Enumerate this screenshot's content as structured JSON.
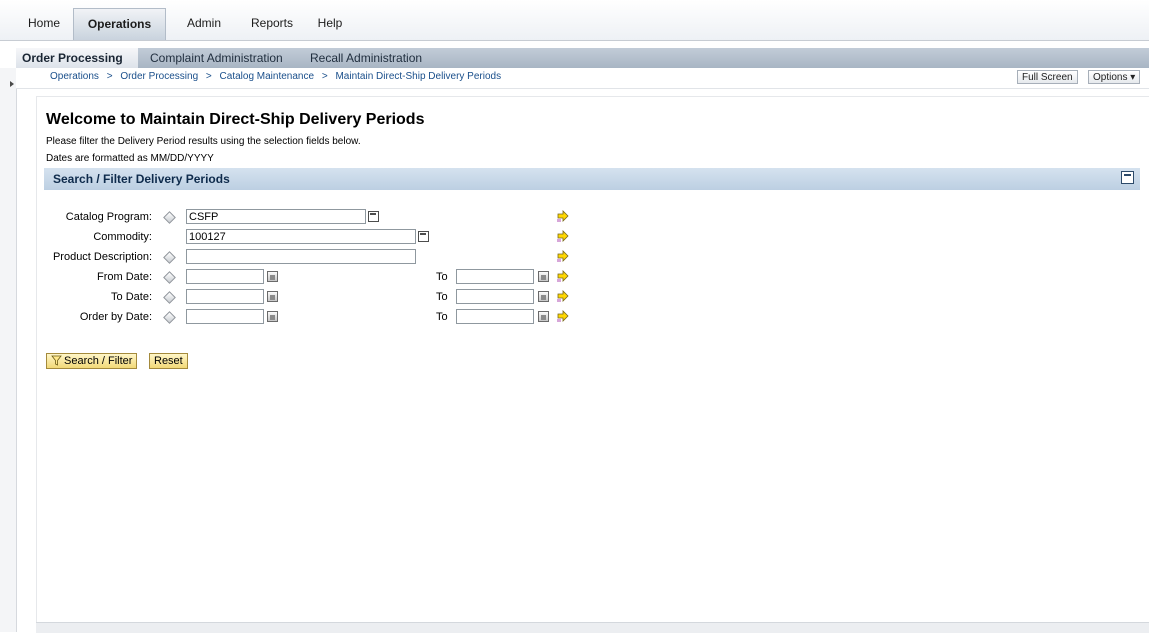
{
  "topnav": {
    "tabs": [
      {
        "label": "Home"
      },
      {
        "label": "Operations",
        "active": true
      },
      {
        "label": "Admin"
      },
      {
        "label": "Reports"
      },
      {
        "label": "Help"
      }
    ]
  },
  "subnav": {
    "tabs": [
      {
        "label": "Order Processing",
        "active": true
      },
      {
        "label": "Complaint Administration"
      },
      {
        "label": "Recall Administration"
      }
    ]
  },
  "breadcrumb": {
    "items": [
      "Operations",
      "Order Processing",
      "Catalog Maintenance",
      "Maintain Direct-Ship Delivery Periods"
    ],
    "separator": ">"
  },
  "toolbar": {
    "full_screen_label": "Full Screen",
    "options_label": "Options ▾"
  },
  "page": {
    "title": "Welcome to Maintain Direct-Ship Delivery Periods",
    "instruction": "Please filter the Delivery Period results using the selection fields below.",
    "date_format_note": "Dates are formatted as MM/DD/YYYY"
  },
  "section": {
    "title": "Search / Filter Delivery Periods"
  },
  "form": {
    "catalog_program": {
      "label": "Catalog Program:",
      "value": "CSFP"
    },
    "commodity": {
      "label": "Commodity:",
      "value": "100127"
    },
    "product_description": {
      "label": "Product Description:",
      "value": ""
    },
    "from_date": {
      "label": "From Date:",
      "value": "",
      "to_label": "To",
      "to_value": ""
    },
    "to_date": {
      "label": "To Date:",
      "value": "",
      "to_label": "To",
      "to_value": ""
    },
    "order_by_date": {
      "label": "Order by Date:",
      "value": "",
      "to_label": "To",
      "to_value": ""
    }
  },
  "actions": {
    "search_filter_label": "Search / Filter",
    "reset_label": "Reset"
  },
  "colors": {
    "accent_blue": "#1a4f8b",
    "section_header_bg": "#c9d9e9",
    "button_yellow": "#f7e39a",
    "arrow_yellow": "#ffd700"
  }
}
